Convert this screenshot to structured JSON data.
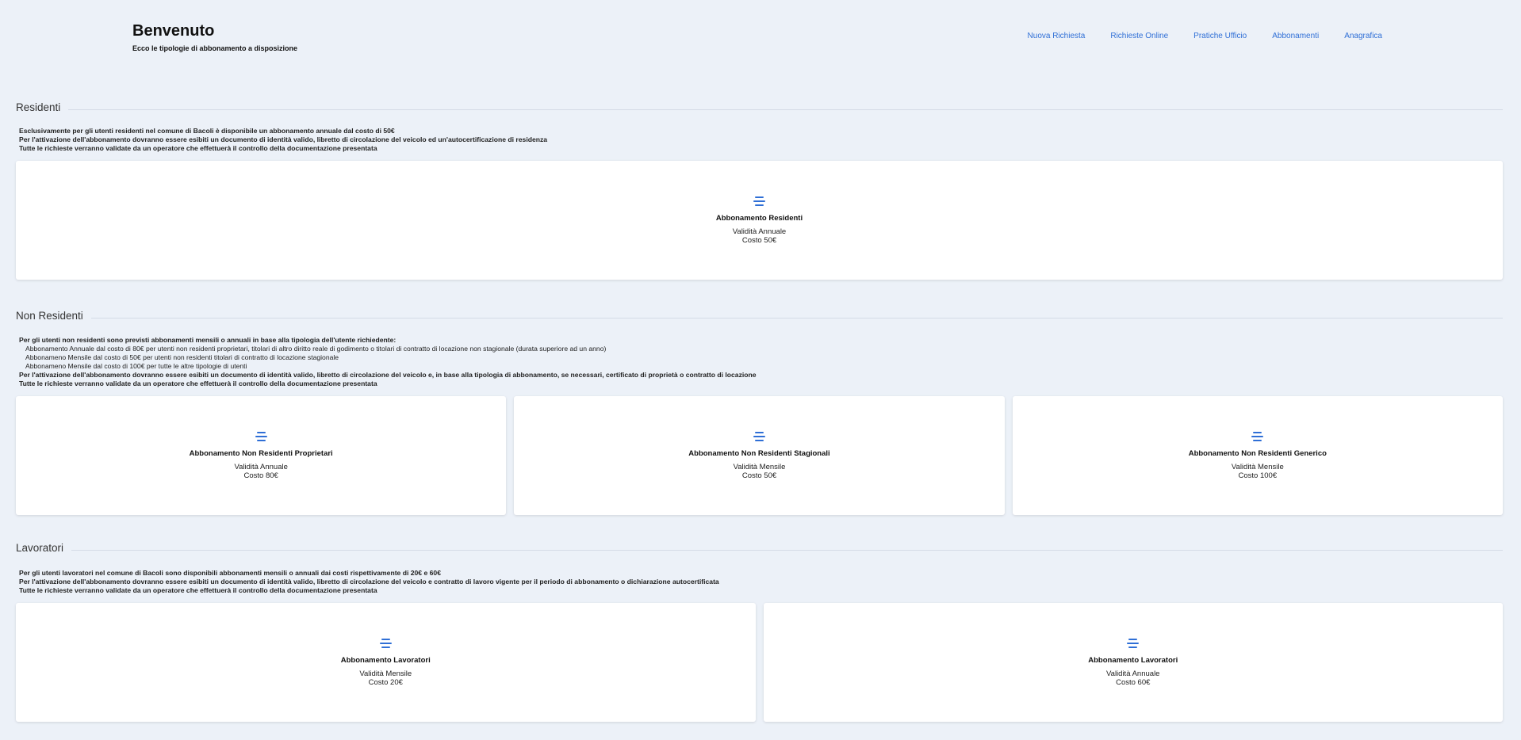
{
  "header": {
    "title": "Benvenuto",
    "subtitle": "Ecco le tipologie di abbonamento a disposizione",
    "nav": [
      "Nuova Richiesta",
      "Richieste Online",
      "Pratiche Ufficio",
      "Abbonamenti",
      "Anagrafica"
    ]
  },
  "residenti": {
    "title": "Residenti",
    "desc": [
      "Esclusivamente per gli utenti residenti nel comune di Bacoli è disponibile un abbonamento annuale dal costo di 50€",
      "Per l'attivazione dell'abbonamento dovranno essere esibiti un documento di identità valido, libretto di circolazione del veicolo ed un'autocertificazione di residenza",
      "Tutte le richieste verranno validate da un operatore che effettuerà il controllo della documentazione presentata"
    ],
    "cards": [
      {
        "title": "Abbonamento Residenti",
        "validity": "Validità Annuale",
        "cost": "Costo 50€"
      }
    ]
  },
  "non_residenti": {
    "title": "Non Residenti",
    "desc_intro": "Per gli utenti non residenti sono previsti abbonamenti mensili o annuali in base alla tipologia dell'utente richiedente:",
    "desc_items": [
      "Abbonamento Annuale dal costo di 80€ per utenti non residenti proprietari, titolari di altro diritto reale di godimento o titolari di contratto di locazione non stagionale (durata superiore ad un anno)",
      "Abbonameno Mensile dal costo di 50€ per utenti non residenti titolari di contratto di locazione stagionale",
      "Abbonameno Mensile dal costo di 100€ per tutte le altre tipologie di utenti"
    ],
    "desc_outro": [
      "Per l'attivazione dell'abbonamento dovranno essere esibiti un documento di identità valido, libretto di circolazione del veicolo e, in base alla tipologia di abbonamento, se necessari, certificato di proprietà o contratto di locazione",
      "Tutte le richieste verranno validate da un operatore che effettuerà il controllo della documentazione presentata"
    ],
    "cards": [
      {
        "title": "Abbonamento Non Residenti Proprietari",
        "validity": "Validità Annuale",
        "cost": "Costo 80€"
      },
      {
        "title": "Abbonamento Non Residenti Stagionali",
        "validity": "Validità Mensile",
        "cost": "Costo 50€"
      },
      {
        "title": "Abbonamento Non Residenti Generico",
        "validity": "Validità Mensile",
        "cost": "Costo 100€"
      }
    ]
  },
  "lavoratori": {
    "title": "Lavoratori",
    "desc": [
      "Per gli utenti lavoratori nel comune di Bacoli sono disponibili abbonamenti mensili o annuali dai costi rispettivamente di 20€ e 60€",
      "Per l'attivazione dell'abbonamento dovranno essere esibiti un documento di identità valido, libretto di circolazione del veicolo e contratto di lavoro vigente per il periodo di abbonamento o dichiarazione autocertificata",
      "Tutte le richieste verranno validate da un operatore che effettuerà il controllo della documentazione presentata"
    ],
    "cards": [
      {
        "title": "Abbonamento Lavoratori",
        "validity": "Validità Mensile",
        "cost": "Costo 20€"
      },
      {
        "title": "Abbonamento Lavoratori",
        "validity": "Validità Annuale",
        "cost": "Costo 60€"
      }
    ]
  },
  "colors": {
    "accent": "#2f6fd6",
    "background": "#ecf1f8"
  }
}
